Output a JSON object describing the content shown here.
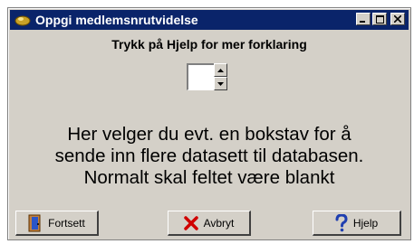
{
  "window": {
    "title": "Oppgi medlemsnrutvidelse",
    "title_icon": "app-icon",
    "controls": {
      "minimize": "minimize-icon",
      "maximize": "maximize-icon",
      "close": "close-icon"
    }
  },
  "dialog": {
    "help_hint": "Trykk på Hjelp for mer forklaring",
    "spinner": {
      "value": ""
    },
    "message_lines": [
      "Her velger du evt. en bokstav for å",
      "sende inn flere datasett til databasen.",
      "Normalt skal feltet være blankt"
    ]
  },
  "buttons": {
    "continue": {
      "label": "Fortsett",
      "icon": "door-icon"
    },
    "cancel": {
      "label": "Avbryt",
      "icon": "red-x-icon"
    },
    "help": {
      "label": "Hjelp",
      "icon": "question-icon"
    }
  },
  "colors": {
    "titlebar": "#0a246a",
    "dialog": "#d4d0c8",
    "cancel_x": "#d00000",
    "help_q": "#1f3fb0"
  }
}
